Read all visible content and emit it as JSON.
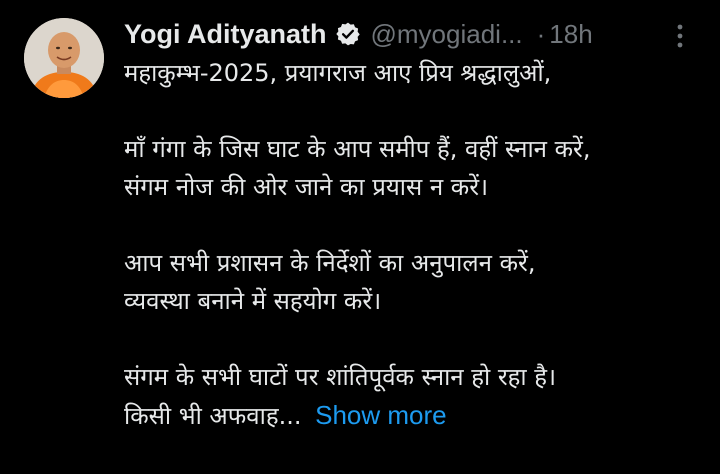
{
  "tweet": {
    "author": {
      "display_name": "Yogi Adityanath",
      "handle": "@myogiadi...",
      "verified_icon": "verified-badge-icon",
      "avatar": "author-avatar"
    },
    "separator": "·",
    "time": "18h",
    "more_icon": "more-options-icon",
    "body": {
      "line1": "महाकुम्भ-2025, प्रयागराज आए प्रिय श्रद्धालुओं,",
      "line2": "माँ गंगा के जिस घाट के आप समीप हैं, वहीं स्नान करें,",
      "line3": "संगम नोज की ओर जाने का प्रयास न करें।",
      "line4": "आप सभी प्रशासन के निर्देशों का अनुपालन करें,",
      "line5": "व्यवस्था बनाने में सहयोग करें।",
      "line6": "संगम के सभी घाटों पर शांतिपूर्वक स्नान हो रहा है।",
      "line7": "किसी भी अफवाह..."
    },
    "show_more_label": "Show more",
    "colors": {
      "background": "#000000",
      "text": "#e7e9ea",
      "secondary": "#71767b",
      "accent": "#1d9bf0"
    }
  }
}
